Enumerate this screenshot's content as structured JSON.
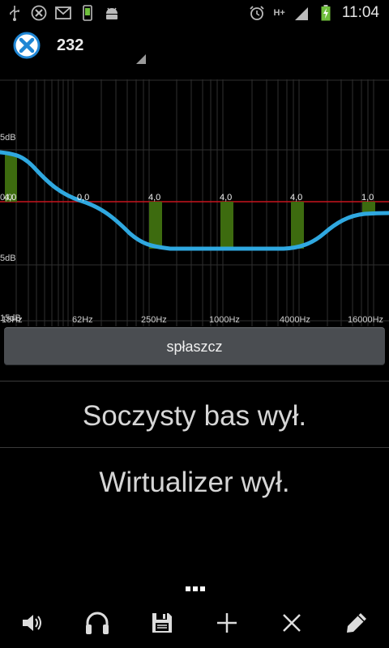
{
  "status_bar": {
    "time": "11:04",
    "icons": [
      "usb-icon",
      "app-x-icon",
      "gmail-icon",
      "phone-icon",
      "android-icon",
      "alarm-icon",
      "hplus-icon",
      "signal-icon",
      "battery-icon"
    ],
    "network": "H+"
  },
  "app_bar": {
    "title": "232",
    "logo_icon": "x-logo-icon"
  },
  "equalizer": {
    "db_labels": {
      "top": "5dB",
      "zero": "0,0",
      "bottom": "5dB",
      "baseline": "15dB"
    },
    "frequency_labels": [
      "15Hz",
      "62Hz",
      "250Hz",
      "1000Hz",
      "4000Hz",
      "16000Hz"
    ],
    "band_values": [
      "4,0",
      "0,0",
      "4,0",
      "4,0",
      "4,0",
      "1,0"
    ],
    "colors": {
      "curve": "#2fa8e0",
      "zero_line": "#c8141e",
      "band": "#3d6b0f",
      "grid": "#3a3a3a"
    }
  },
  "preset_button": {
    "label": "spłaszcz"
  },
  "toggles": {
    "bass": "Soczysty bas wył.",
    "virtualizer": "Wirtualizer wył."
  },
  "bottom_bar": {
    "buttons": [
      "speaker-icon",
      "headphones-icon",
      "save-icon",
      "plus-icon",
      "close-icon",
      "pencil-icon"
    ]
  }
}
